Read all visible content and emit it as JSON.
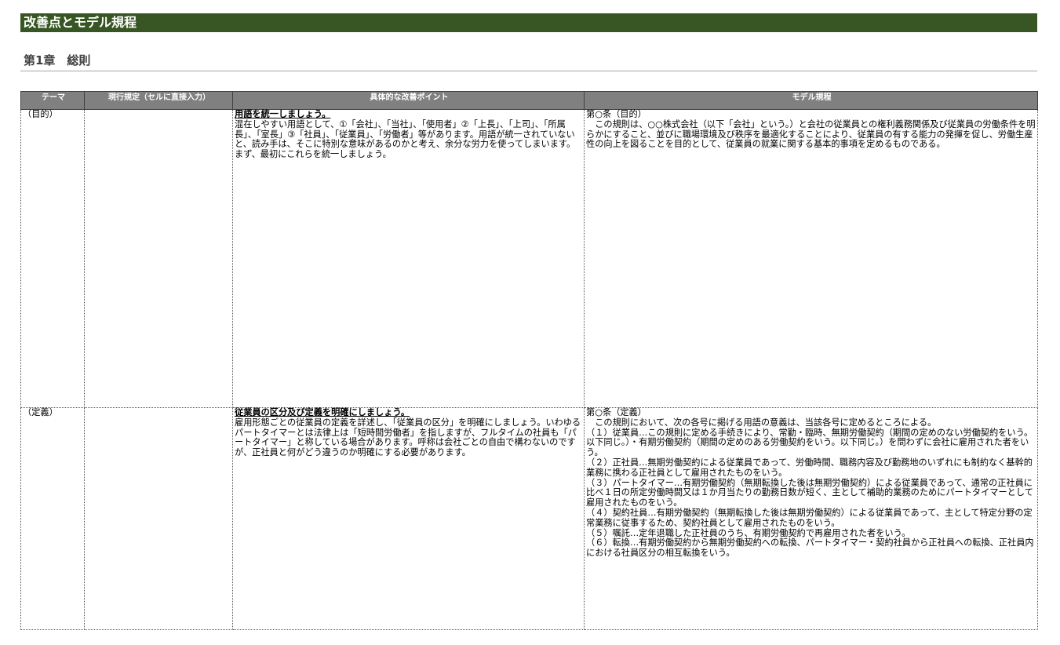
{
  "header": {
    "title": "改善点とモデル規程"
  },
  "chapter": {
    "title": "第1章　総則"
  },
  "table": {
    "headers": [
      "テーマ",
      "現行規定（セルに直接入力）",
      "具体的な改善ポイント",
      "モデル規程"
    ],
    "rows": [
      {
        "theme": "（目的）",
        "current": "",
        "point_title": "用語を統一しましょう。",
        "point_text": "混在しやすい用語として、①「会社」、「当社」、「使用者」②「上長」、「上司」、「所属長」、「室長」③「社員」、「従業員」、「労働者」等があります。用語が統一されていないと、読み手は、そこに特別な意味があるのかと考え、余分な労力を使ってしまいます。まず、最初にこれらを統一しましょう。",
        "model_text": "第○条（目的）\n　この規則は、○○株式会社（以下「会社」という。）と会社の従業員との権利義務関係及び従業員の労働条件を明らかにすること、並びに職場環境及び秩序を最適化することにより、従業員の有する能力の発揮を促し、労働生産性の向上を図ることを目的として、従業員の就業に関する基本的事項を定めるものである。"
      },
      {
        "theme": "（定義）",
        "current": "",
        "point_title": "従業員の区分及び定義を明確にしましょう。",
        "point_text": "雇用形態ごとの従業員の定義を詳述し、「従業員の区分」を明確にしましょう。いわゆるパートタイマーとは法律上は「短時間労働者」を指しますが、フルタイムの社員も「パートタイマー」と称している場合があります。呼称は会社ごとの自由で構わないのですが、正社員と何がどう違うのか明確にする必要があります。",
        "model_text": "第○条（定義）\n　この規則において、次の各号に掲げる用語の意義は、当該各号に定めるところによる。\n（１）従業員…この規則に定める手続きにより、常勤・臨時、無期労働契約（期間の定めのない労働契約をいう。以下同じ。）・有期労働契約（期間の定めのある労働契約をいう。以下同じ。）を問わずに会社に雇用された者をいう。\n（２）正社員…無期労働契約による従業員であって、労働時間、職務内容及び勤務地のいずれにも制約なく基幹的業務に携わる正社員として雇用されたものをいう。\n（３）パートタイマー…有期労働契約（無期転換した後は無期労働契約）による従業員であって、通常の正社員に比べ１日の所定労働時間又は１か月当たりの勤務日数が短く、主として補助的業務のためにパートタイマーとして雇用されたものをいう。\n（４）契約社員…有期労働契約（無期転換した後は無期労働契約）による従業員であって、主として特定分野の定常業務に従事するため、契約社員として雇用されたものをいう。\n（５）嘱託…定年退職した正社員のうち、有期労働契約で再雇用された者をいう。\n（６）転換…有期労働契約から無期労働契約への転換、パートタイマー・契約社員から正社員への転換、正社員内における社員区分の相互転換をいう。"
      }
    ]
  }
}
